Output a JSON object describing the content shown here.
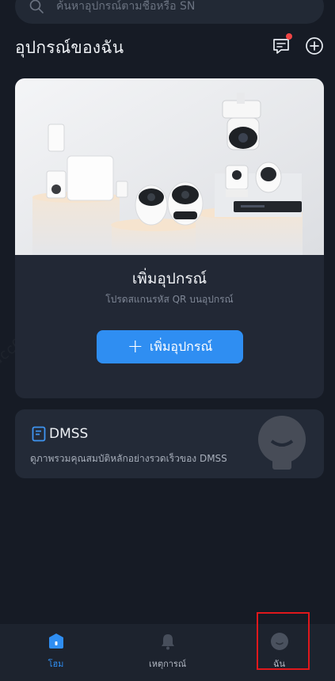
{
  "search": {
    "placeholder": "ค้นหาอุปกรณ์ตามชื่อหรือ SN"
  },
  "header": {
    "title": "อุปกรณ์ของฉัน"
  },
  "card": {
    "title": "เพิ่มอุปกรณ์",
    "subtitle": "โปรดสแกนรหัส QR บนอุปกรณ์",
    "button_label": "เพิ่มอุปกรณ์"
  },
  "dmss": {
    "name": "DMSS",
    "description": "ดูภาพรวมคุณสมบัติหลักอย่างรวดเร็วของ DMSS"
  },
  "nav": {
    "items": [
      {
        "label": "โฮม",
        "icon": "home-icon",
        "active": true
      },
      {
        "label": "เหตุการณ์",
        "icon": "bell-icon",
        "active": false
      },
      {
        "label": "ฉัน",
        "icon": "avatar-icon",
        "active": false
      }
    ]
  },
  "colors": {
    "accent": "#2f8ef2",
    "background": "#161b25",
    "card": "#222835",
    "notification_dot": "#ef4545",
    "highlight_box": "#e0181c"
  }
}
